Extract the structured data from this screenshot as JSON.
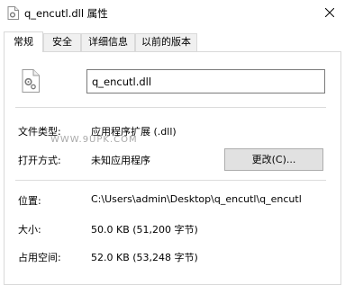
{
  "window": {
    "title": "q_encutl.dll 属性"
  },
  "tabs": [
    {
      "label": "常规"
    },
    {
      "label": "安全"
    },
    {
      "label": "详细信息"
    },
    {
      "label": "以前的版本"
    }
  ],
  "general": {
    "file_name": "q_encutl.dll",
    "file_type_label": "文件类型:",
    "file_type_value": "应用程序扩展 (.dll)",
    "open_with_label": "打开方式:",
    "open_with_value": "未知应用程序",
    "change_button": "更改(C)...",
    "location_label": "位置:",
    "location_value": "C:\\Users\\admin\\Desktop\\q_encutl\\q_encutl",
    "size_label": "大小:",
    "size_value": "50.0 KB (51,200 字节)",
    "size_on_disk_label": "占用空间:",
    "size_on_disk_value": "52.0 KB (53,248 字节)"
  },
  "watermark": "WWW.9UPK.COM",
  "icons": {
    "title": "dll-file-icon",
    "file": "dll-gear-file-icon",
    "close": "close-icon"
  }
}
